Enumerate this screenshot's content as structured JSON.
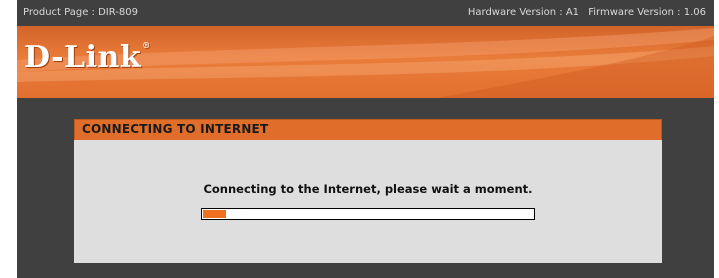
{
  "header": {
    "product_page": "Product Page : DIR-809",
    "hardware_version": "Hardware Version : A1",
    "firmware_version": "Firmware Version : 1.06"
  },
  "brand": {
    "logo_text": "D-Link",
    "registered_mark": "®"
  },
  "panel": {
    "title": "CONNECTING TO INTERNET",
    "message": "Connecting to the Internet, please wait a moment.",
    "progress_fraction": 0.07
  },
  "colors": {
    "accent": "#e06e2a",
    "progress_fill": "#f07020",
    "frame": "#404040",
    "panel_body": "#dedede"
  }
}
